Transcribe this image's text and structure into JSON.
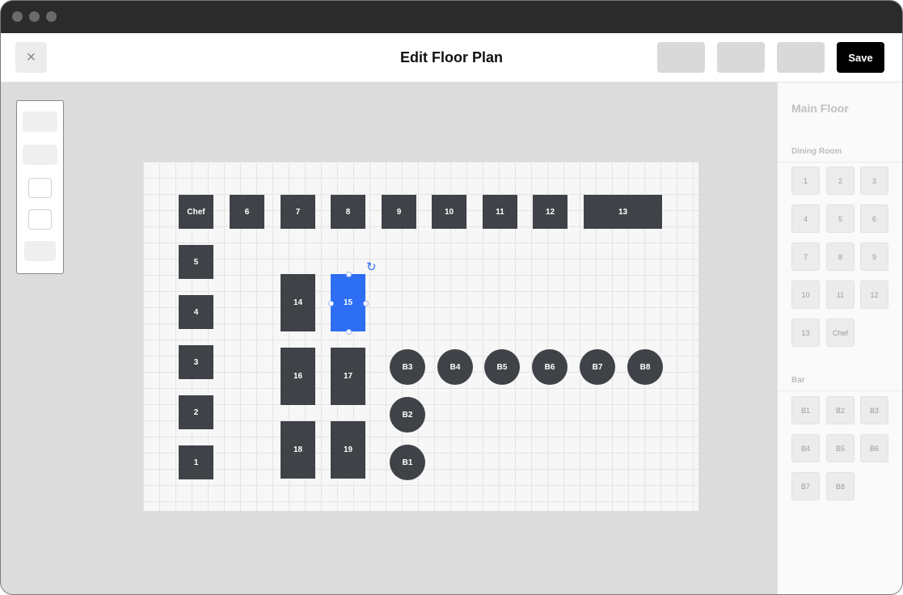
{
  "window": {
    "title": "Edit Floor Plan",
    "controls": [
      "window-close-dot",
      "window-minimize-dot",
      "window-maximize-dot"
    ]
  },
  "header": {
    "close_icon": "×",
    "title": "Edit Floor Plan",
    "save_label": "Save"
  },
  "floor_plan": {
    "selected_table": "15",
    "rotate_icon": "↻",
    "tables": [
      "Chef",
      "6",
      "7",
      "8",
      "9",
      "10",
      "11",
      "12",
      "13",
      "5",
      "4",
      "3",
      "2",
      "1",
      "14",
      "15",
      "16",
      "17",
      "18",
      "19",
      "B3",
      "B4",
      "B5",
      "B6",
      "B7",
      "B8",
      "B2",
      "B1"
    ]
  },
  "side_panel": {
    "title": "Main Floor",
    "sections": [
      {
        "label": "Dining Room",
        "tiles": [
          "1",
          "2",
          "3",
          "4",
          "5",
          "6",
          "7",
          "8",
          "9",
          "10",
          "11",
          "12",
          "13",
          "Chef"
        ]
      },
      {
        "label": "Bar",
        "tiles": [
          "B1",
          "B2",
          "B3",
          "B4",
          "B5",
          "B6",
          "B7",
          "B8"
        ]
      }
    ]
  },
  "colors": {
    "titlebar": "#2b2b2b",
    "table": "#3f4247",
    "selected": "#2d6ef5",
    "save": "#000000"
  }
}
